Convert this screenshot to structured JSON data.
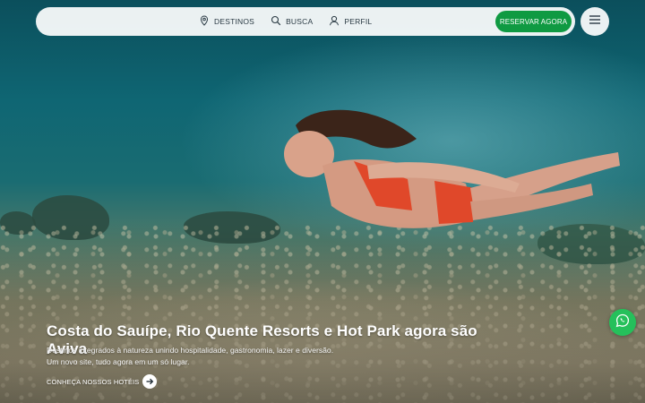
{
  "nav": {
    "links": [
      {
        "label": "DESTINOS",
        "icon": "location-pin-icon"
      },
      {
        "label": "BUSCA",
        "icon": "search-icon"
      },
      {
        "label": "PERFIL",
        "icon": "user-icon"
      }
    ],
    "cta_label": "RESERVAR AGORA",
    "menu_icon": "hamburger-menu-icon"
  },
  "hero": {
    "headline": "Costa do Sauípe, Rio Quente Resorts e Hot Park agora são Aviva",
    "sub_line1": "Destinos integrados à natureza unindo hospitalidade, gastronomia, lazer e diversão.",
    "sub_line2": "Um novo site, tudo agora em um só lugar.",
    "link_label": "CONHEÇA NOSSOS HOTÉIS",
    "link_icon": "arrow-right-icon",
    "image_description": "woman-swimming-underwater"
  },
  "whatsapp": {
    "icon": "whatsapp-icon"
  },
  "colors": {
    "accent_green": "#0f9a42",
    "whatsapp_green": "#25c05b",
    "nav_text": "#2a3a44"
  }
}
